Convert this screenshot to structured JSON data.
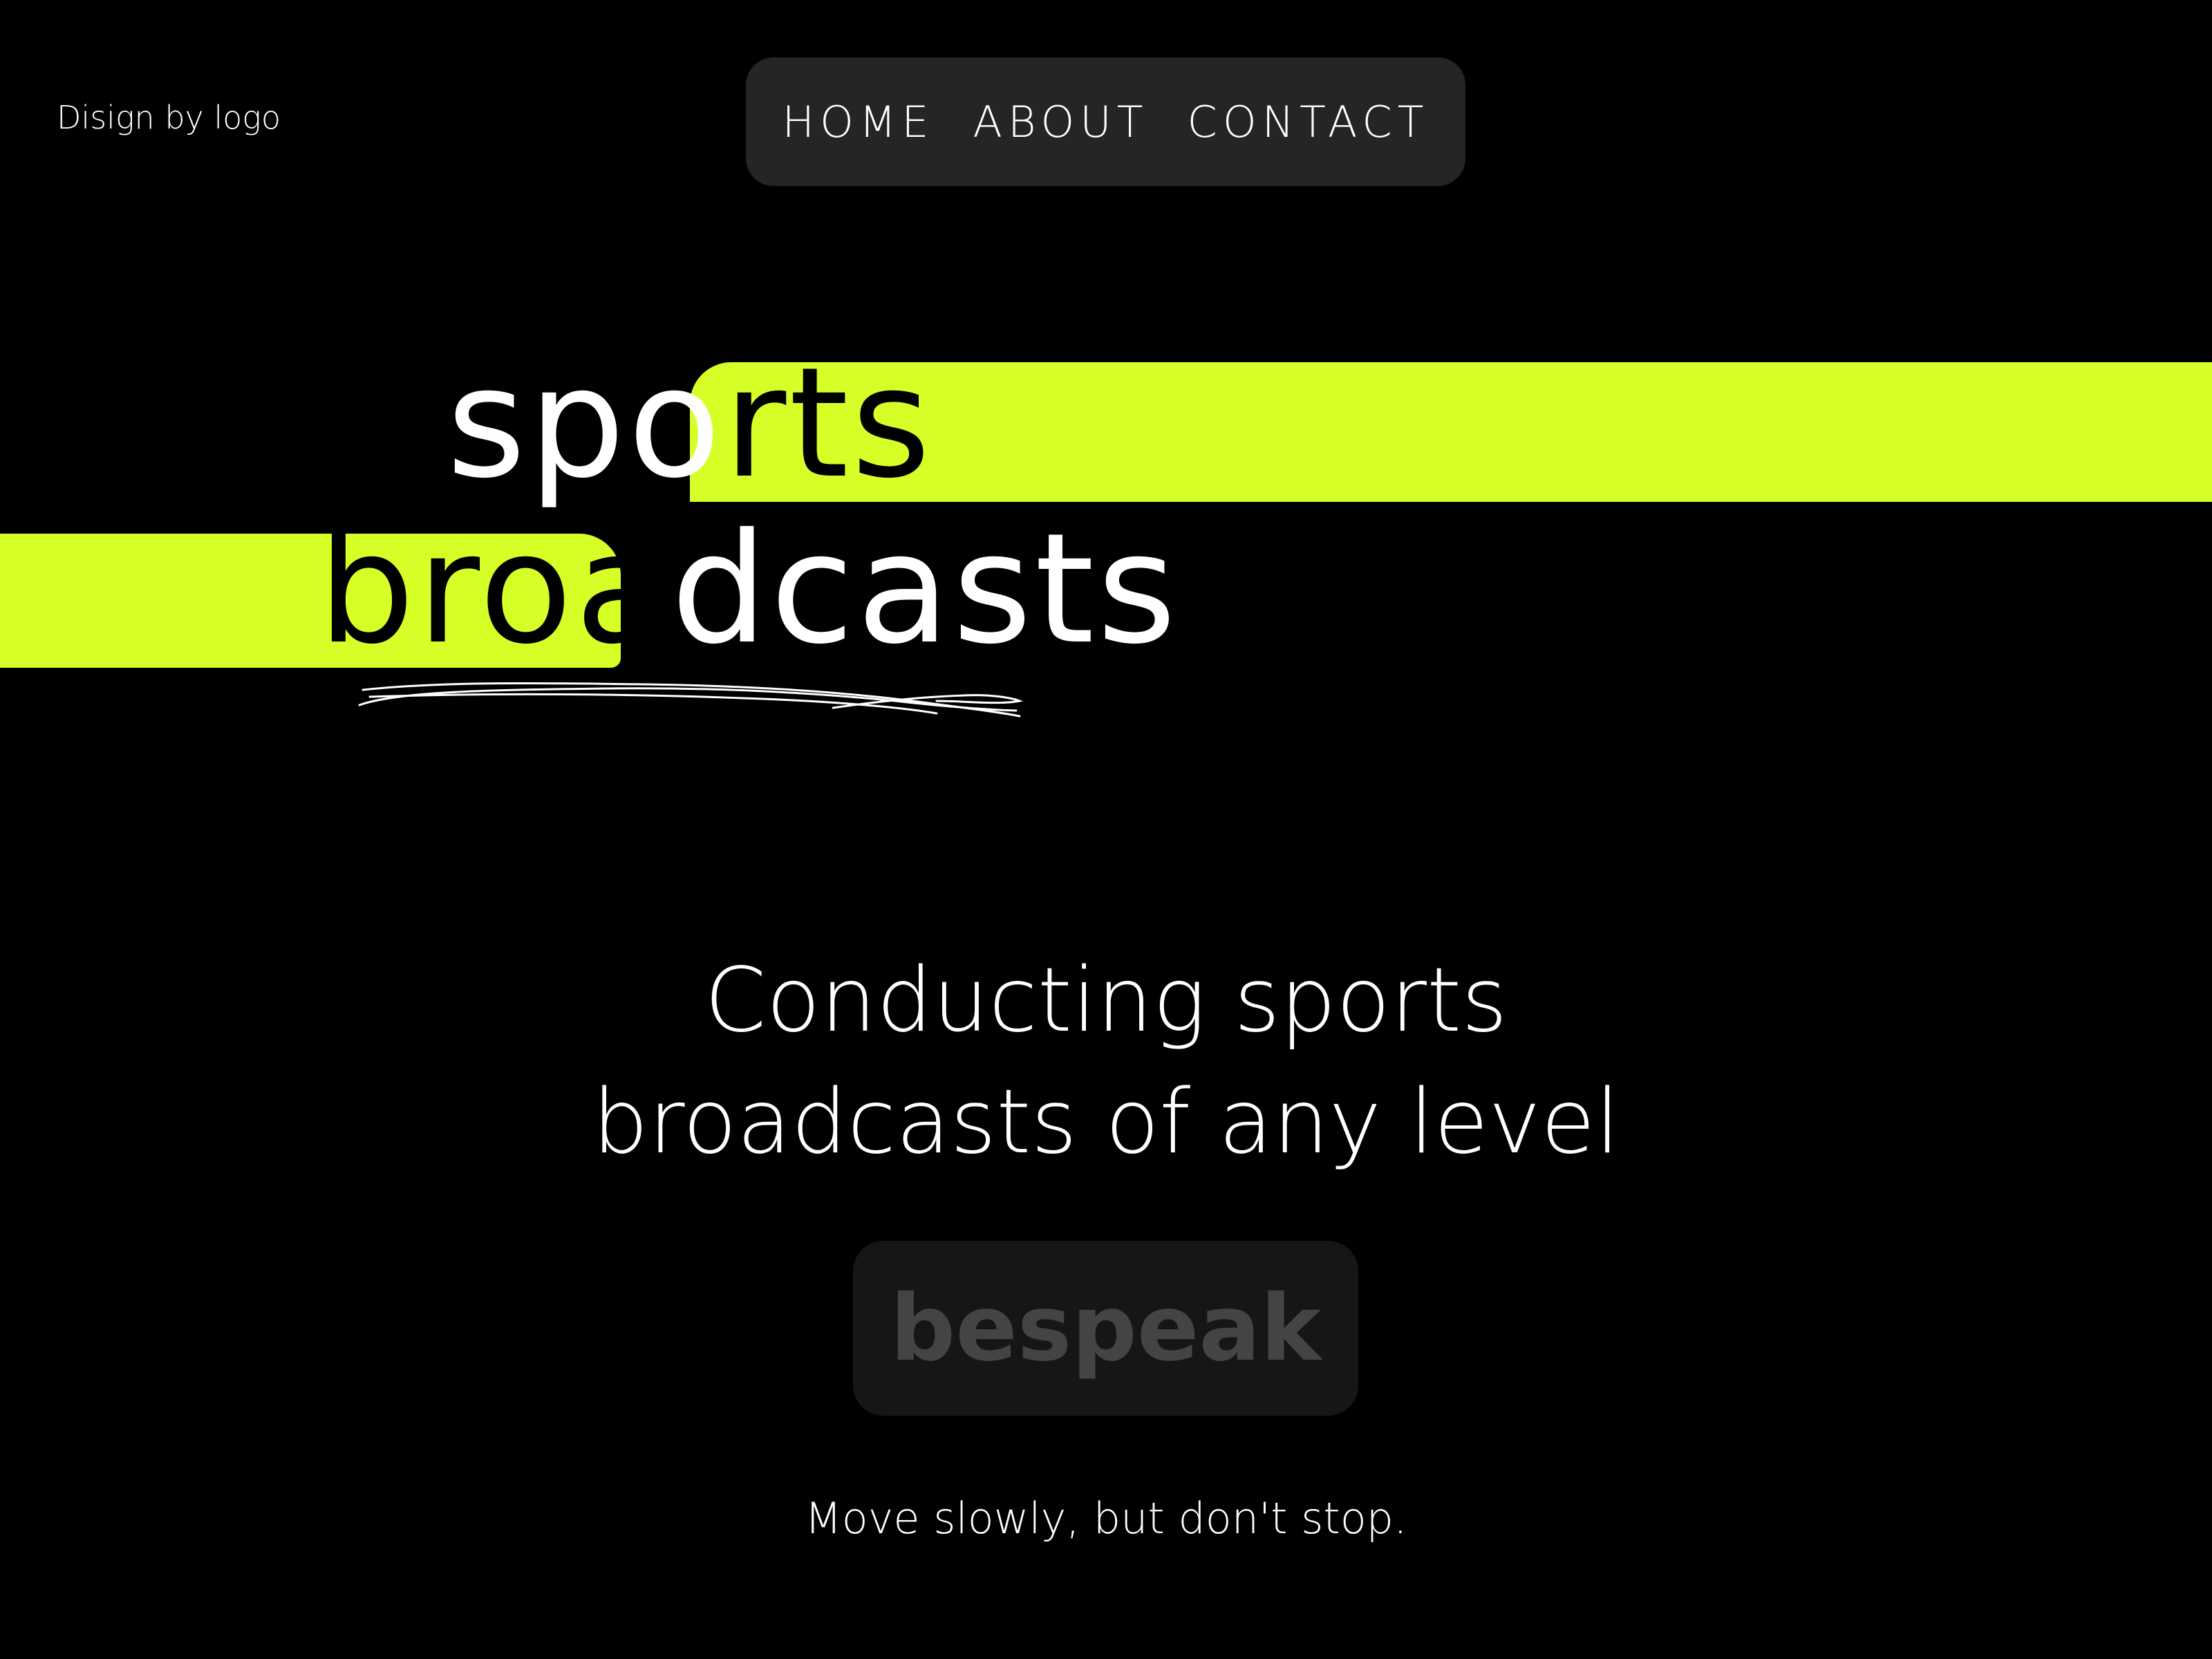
{
  "brand": {
    "text": "Disign by logo"
  },
  "nav": {
    "items": [
      {
        "label": "HOME"
      },
      {
        "label": "ABOUT"
      },
      {
        "label": "CONTACT"
      }
    ]
  },
  "hero": {
    "line1_light": "spo",
    "line1_dark": "rts",
    "line2_dark": "broa",
    "line2_light": "dcasts"
  },
  "tagline": {
    "line1": "Conducting sports",
    "line2": "broadcasts of any level"
  },
  "cta": {
    "label": "bespeak"
  },
  "motto": {
    "text": "Move slowly, but don't stop."
  },
  "colors": {
    "background": "#000000",
    "accent": "#d6ff27",
    "nav_background": "#252525",
    "button_background": "#161616",
    "button_text": "#444444",
    "text": "#ffffff"
  },
  "icons": {
    "scribble": "hand-drawn-underline"
  }
}
